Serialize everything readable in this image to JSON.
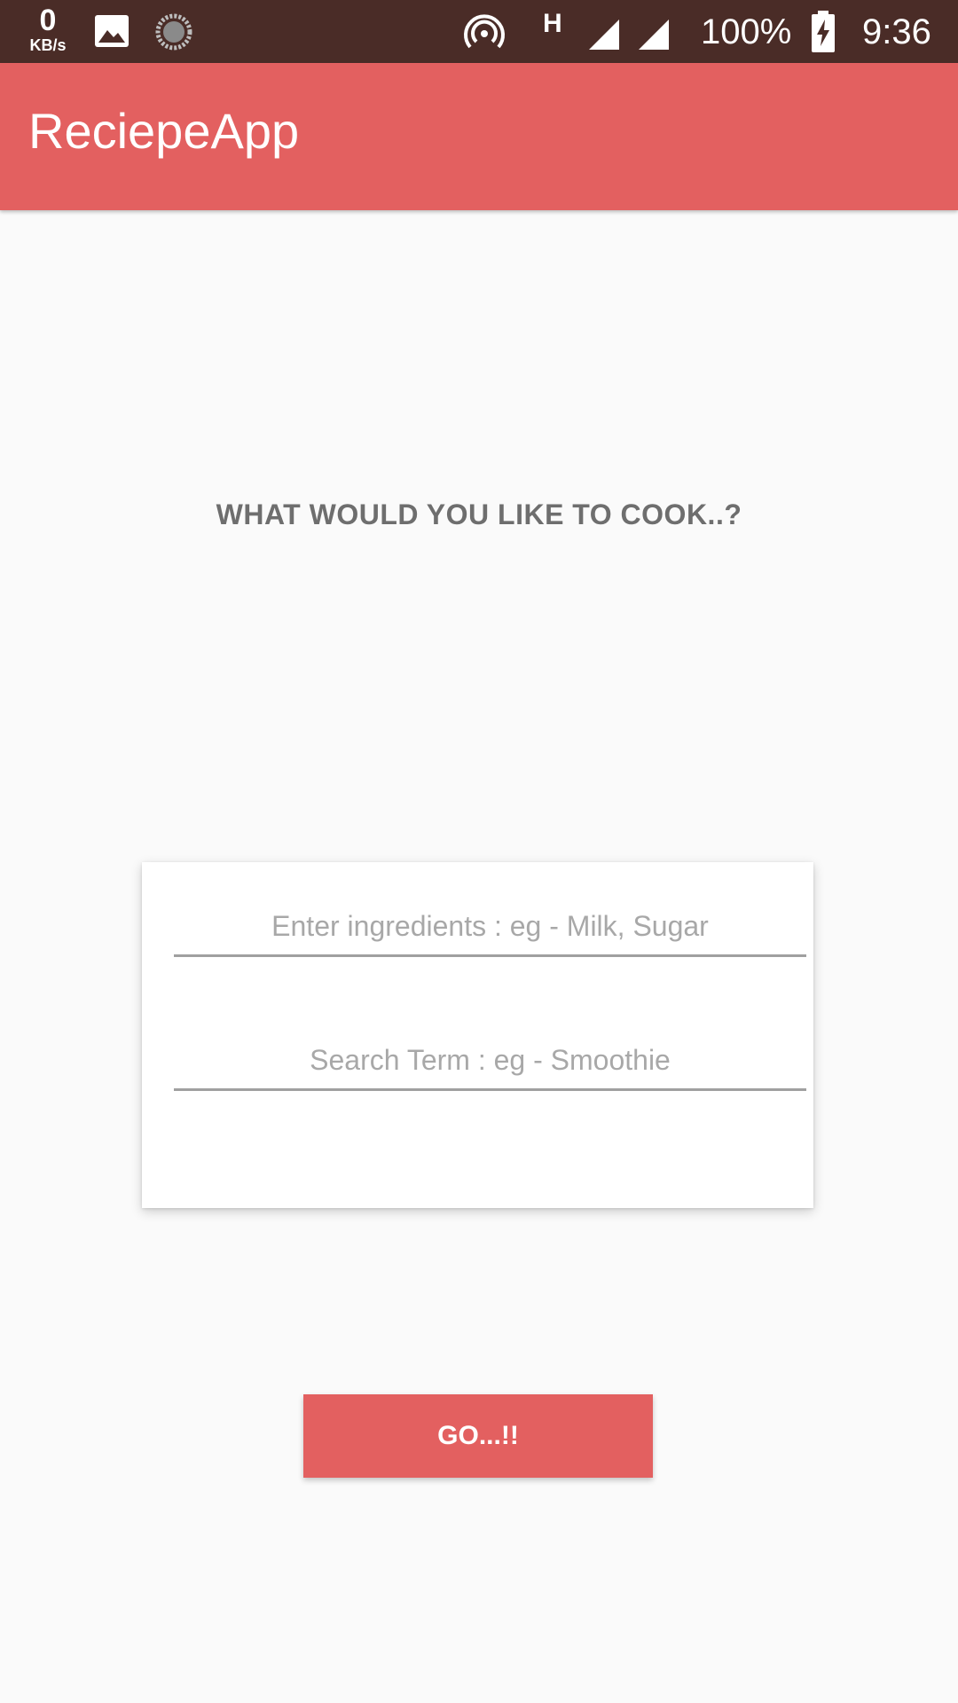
{
  "status_bar": {
    "net_speed_value": "0",
    "net_speed_unit": "KB/s",
    "network_type": "H",
    "battery_percent": "100%",
    "time": "9:36",
    "icons": [
      "image-icon",
      "sync-spinner-icon",
      "hotspot-icon",
      "signal-icon",
      "signal-icon",
      "battery-charging-icon"
    ],
    "background_color": "#4a2c27"
  },
  "app_bar": {
    "title": "ReciepeApp",
    "background_color": "#e36060"
  },
  "main": {
    "prompt": "WHAT WOULD YOU LIKE TO COOK..?",
    "ingredients_input": {
      "value": "",
      "placeholder": "Enter ingredients : eg - Milk, Sugar"
    },
    "search_input": {
      "value": "",
      "placeholder": "Search Term : eg - Smoothie"
    },
    "go_button_label": "GO...!!",
    "accent_color": "#e36060"
  }
}
